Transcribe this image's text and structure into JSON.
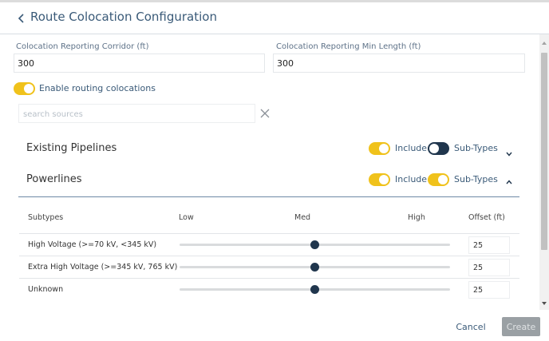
{
  "header": {
    "title": "Route Colocation Configuration",
    "back_icon": "chevron-left-icon"
  },
  "fields": {
    "corridor": {
      "label": "Colocation Reporting Corridor (ft)",
      "value": "300"
    },
    "min_length": {
      "label": "Colocation Reporting Min Length (ft)",
      "value": "300"
    }
  },
  "enable_routing": {
    "label": "Enable routing colocations",
    "checked": true
  },
  "search": {
    "placeholder": "search sources",
    "value": "",
    "clear_icon": "close-icon"
  },
  "sections": {
    "existing_pipelines": {
      "title": "Existing Pipelines",
      "include_label": "Include",
      "include_on": true,
      "subtypes_label": "Sub-Types",
      "subtypes_on": false,
      "expanded": false,
      "chevron_icon": "chevron-down-icon"
    },
    "powerlines": {
      "title": "Powerlines",
      "include_label": "Include",
      "include_on": true,
      "subtypes_label": "Sub-Types",
      "subtypes_on": true,
      "expanded": true,
      "chevron_icon": "chevron-up-icon"
    }
  },
  "subtypes_table": {
    "headers": {
      "subtypes": "Subtypes",
      "low": "Low",
      "med": "Med",
      "high": "High",
      "offset": "Offset (ft)"
    },
    "rows": [
      {
        "label": "High Voltage (>=70 kV, <345 kV)",
        "level": 0.5,
        "offset": "25"
      },
      {
        "label": "Extra High Voltage (>=345 kV, 765 kV)",
        "level": 0.5,
        "offset": "25"
      },
      {
        "label": "Unknown",
        "level": 0.5,
        "offset": "25"
      }
    ]
  },
  "footer": {
    "cancel_label": "Cancel",
    "create_label": "Create"
  },
  "colors": {
    "accent": "#f0c21b",
    "navy": "#20364d",
    "link": "#3a5a78",
    "disabled": "#9aa0a4"
  }
}
